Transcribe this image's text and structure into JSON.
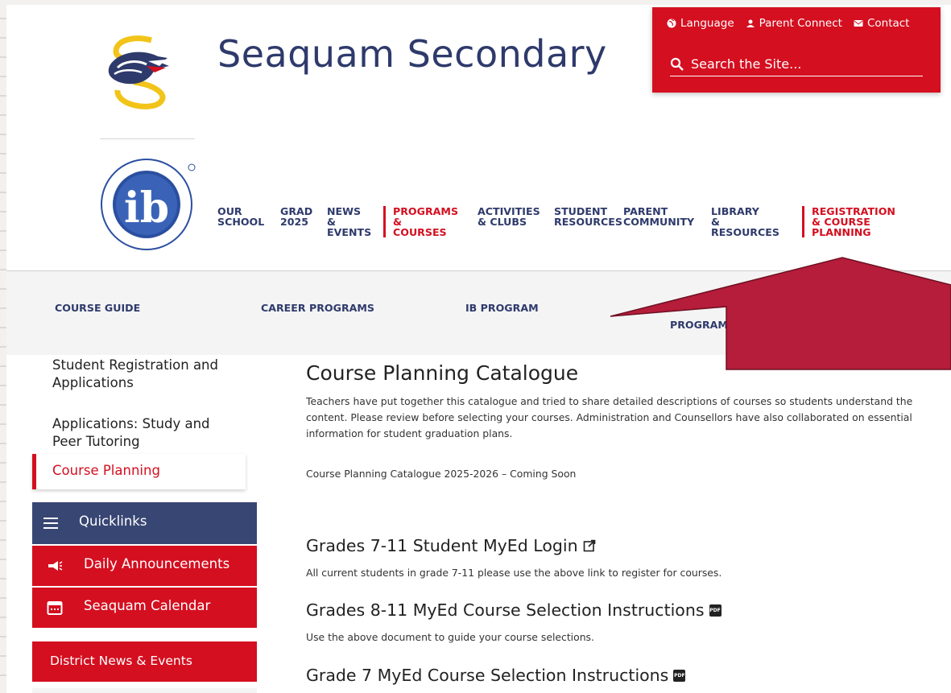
{
  "header": {
    "site_title": "Seaquam Secondary"
  },
  "utility": {
    "language_label": "Language",
    "parent_connect_label": "Parent Connect",
    "contact_label": "Contact",
    "search_placeholder": "Search the Site..."
  },
  "main_nav": {
    "items": [
      {
        "label": "OUR\nSCHOOL"
      },
      {
        "label": "GRAD\n2025"
      },
      {
        "label": "NEWS\n&\nEVENTS"
      },
      {
        "label": "PROGRAMS\n& COURSES"
      },
      {
        "label": "ACTIVITIES\n& CLUBS"
      },
      {
        "label": "STUDENT\nRESOURCES"
      },
      {
        "label": "PARENT\nCOMMUNITY"
      },
      {
        "label": "LIBRARY\n&\nRESOURCES"
      },
      {
        "label": "REGISTRATION\n& COURSE\nPLANNING"
      }
    ]
  },
  "sub_nav": {
    "items": [
      {
        "label": "COURSE GUIDE"
      },
      {
        "label": "CAREER PROGRAMS"
      },
      {
        "label": "IB PROGRAM"
      },
      {
        "label": "PROGRAM"
      }
    ]
  },
  "sidebar": {
    "items": [
      {
        "label": "Student Registration and Applications"
      },
      {
        "label": "Applications: Study and Peer Tutoring"
      },
      {
        "label": "Course Planning"
      }
    ],
    "quicklinks_label": "Quicklinks",
    "quicklinks": [
      {
        "label": "Daily Announcements",
        "icon": "megaphone-icon"
      },
      {
        "label": "Seaquam Calendar",
        "icon": "calendar-icon"
      }
    ],
    "district_label": "District News & Events"
  },
  "content": {
    "title": "Course Planning Catalogue",
    "intro": "Teachers have put together this catalogue and tried to share detailed descriptions of courses so students understand the content. Please review before selecting your courses. Administration and Counsellors have also collaborated on essential information for student graduation plans.",
    "catalogue_note": "Course Planning Catalogue 2025-2026 – Coming Soon",
    "sections": [
      {
        "heading": "Grades 7-11 Student MyEd Login",
        "icon": "external-link-icon",
        "text": "All current students in grade 7-11 please use the above link to register for courses."
      },
      {
        "heading": "Grades 8-11 MyEd Course Selection Instructions",
        "icon": "pdf-icon",
        "text": "Use the above document to guide your course selections."
      },
      {
        "heading": "Grade 7 MyEd Course Selection Instructions",
        "icon": "pdf-icon",
        "text": ""
      }
    ],
    "pdf_badge": "PDF"
  },
  "colors": {
    "brand_red": "#d40f20",
    "brand_navy": "#2e3a6b",
    "annotation_arrow": "#b51d3a"
  }
}
